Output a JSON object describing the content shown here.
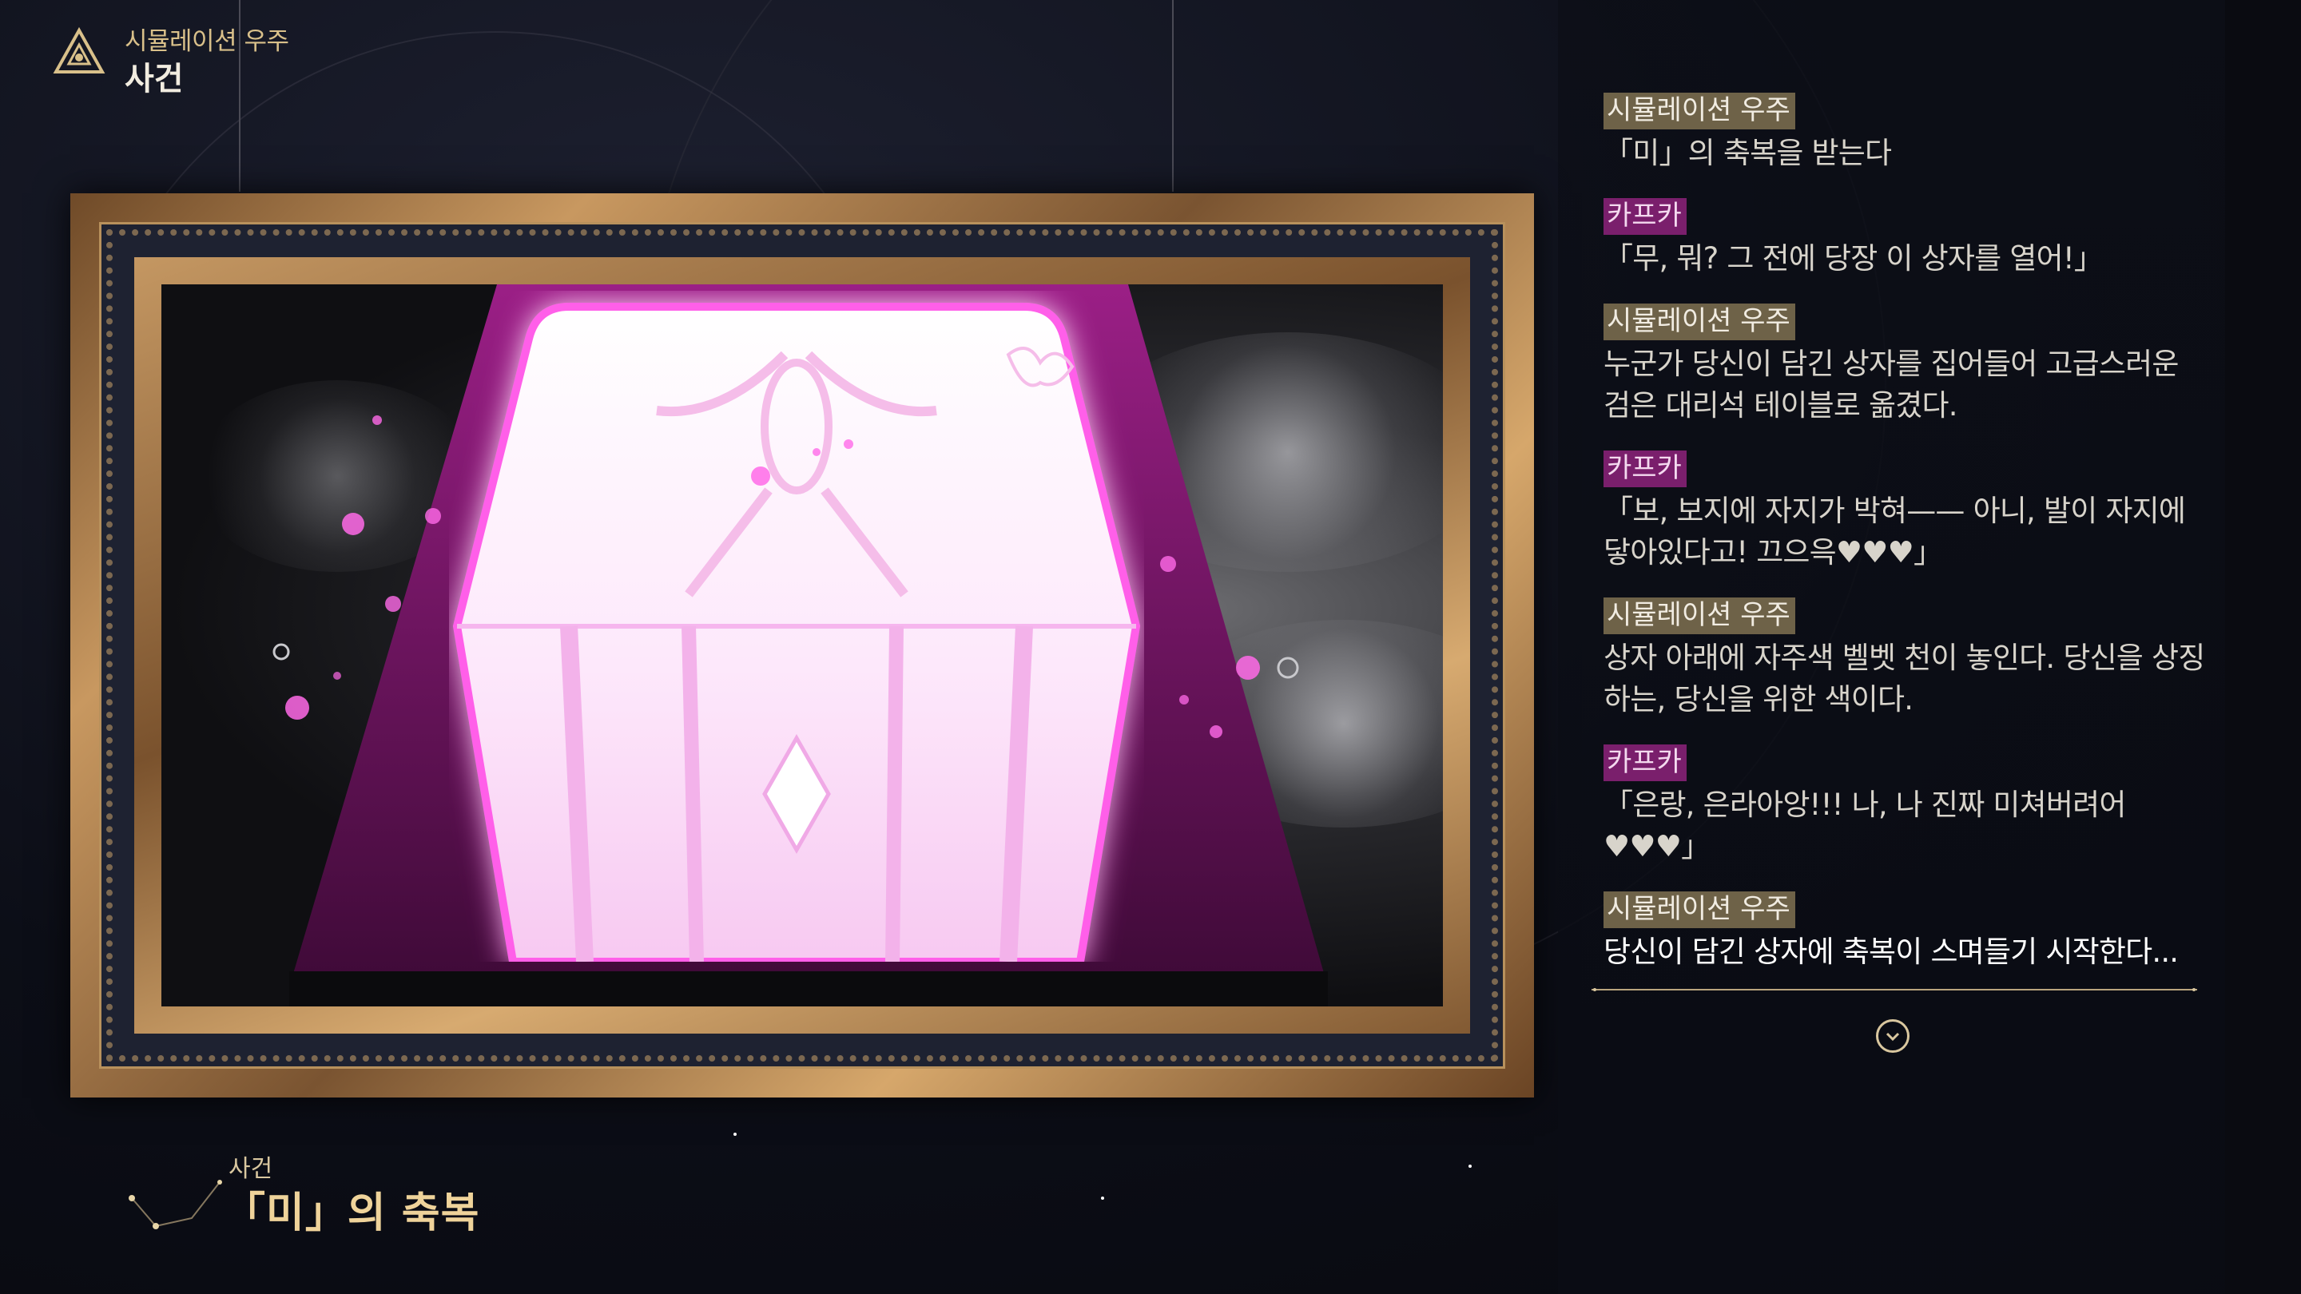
{
  "header": {
    "subtitle": "시뮬레이션 우주",
    "title": "사건"
  },
  "caption": {
    "subtitle": "사건",
    "title": "「미」의 축복"
  },
  "dialogue": [
    {
      "speaker": "시뮬레이션 우주",
      "speaker_type": "sim",
      "text": "「미」의 축복을 받는다"
    },
    {
      "speaker": "카프카",
      "speaker_type": "kafka",
      "text": "「무, 뭐? 그 전에 당장 이 상자를 열어!」"
    },
    {
      "speaker": "시뮬레이션 우주",
      "speaker_type": "sim",
      "text": "누군가 당신이 담긴 상자를 집어들어 고급스러운 검은 대리석 테이블로 옮겼다."
    },
    {
      "speaker": "카프카",
      "speaker_type": "kafka",
      "text": "「보, 보지에 자지가 박혀—— 아니, 발이 자지에 닿아있다고! 끄으윽♥♥♥」"
    },
    {
      "speaker": "시뮬레이션 우주",
      "speaker_type": "sim",
      "text": "상자 아래에 자주색 벨벳 천이 놓인다. 당신을 상징하는, 당신을 위한 색이다."
    },
    {
      "speaker": "카프카",
      "speaker_type": "kafka",
      "text": "「은랑, 은라아앙!!! 나, 나 진짜 미쳐버려어♥♥♥」"
    },
    {
      "speaker": "시뮬레이션 우주",
      "speaker_type": "sim",
      "text": "당신이 담긴 상자에 축복이 스며들기 시작한다..."
    }
  ],
  "icons": {
    "header": "trailblaze-emblem-icon",
    "next": "chevron-down-icon"
  },
  "colors": {
    "speaker_sim_bg": "#6e6248",
    "speaker_kafka_bg": "#7a1f6c",
    "gold": "#d9c08a",
    "box_glow": "#ff6af0"
  }
}
